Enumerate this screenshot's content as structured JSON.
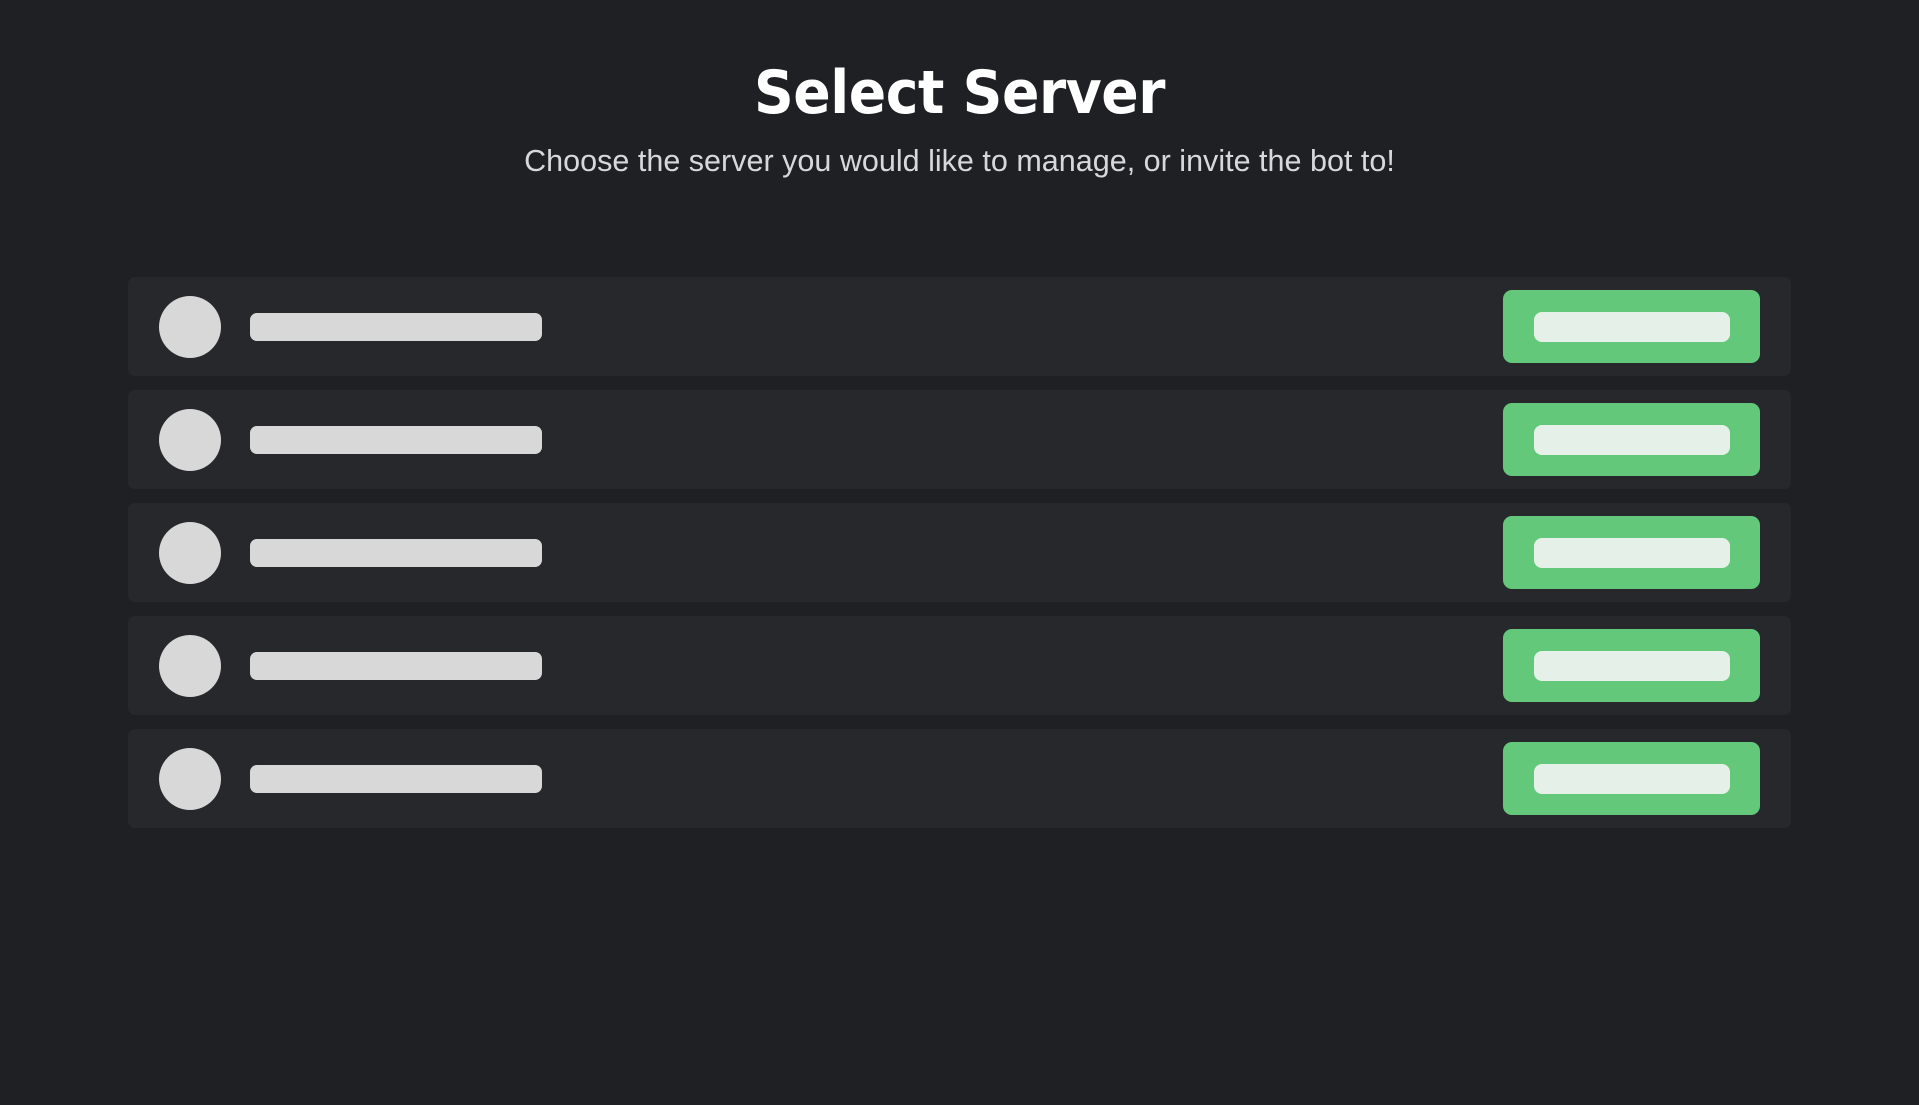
{
  "page": {
    "background_color": "#1e2023",
    "title": "Select Server",
    "subtitle": "Choose the server you would like to manage, or invite the bot to!"
  },
  "theme": {
    "page_background": "#1e2023",
    "card_background": "#26282c",
    "accent_green": "#64c87b",
    "skeleton_gray": "#d8d8d8",
    "skeleton_light_green": "#e5f1e8",
    "title_color": "#ffffff",
    "subtitle_color": "#d5d9dd"
  },
  "server_list": {
    "state": "loading",
    "rows": [
      {
        "avatar_placeholder": "server-avatar-skeleton",
        "name_placeholder": "server-name-skeleton",
        "action_placeholder": "manage-button-label-skeleton"
      },
      {
        "avatar_placeholder": "server-avatar-skeleton",
        "name_placeholder": "server-name-skeleton",
        "action_placeholder": "manage-button-label-skeleton"
      },
      {
        "avatar_placeholder": "server-avatar-skeleton",
        "name_placeholder": "server-name-skeleton",
        "action_placeholder": "manage-button-label-skeleton"
      },
      {
        "avatar_placeholder": "server-avatar-skeleton",
        "name_placeholder": "server-name-skeleton",
        "action_placeholder": "manage-button-label-skeleton"
      },
      {
        "avatar_placeholder": "server-avatar-skeleton",
        "name_placeholder": "server-name-skeleton",
        "action_placeholder": "manage-button-label-skeleton"
      }
    ]
  }
}
